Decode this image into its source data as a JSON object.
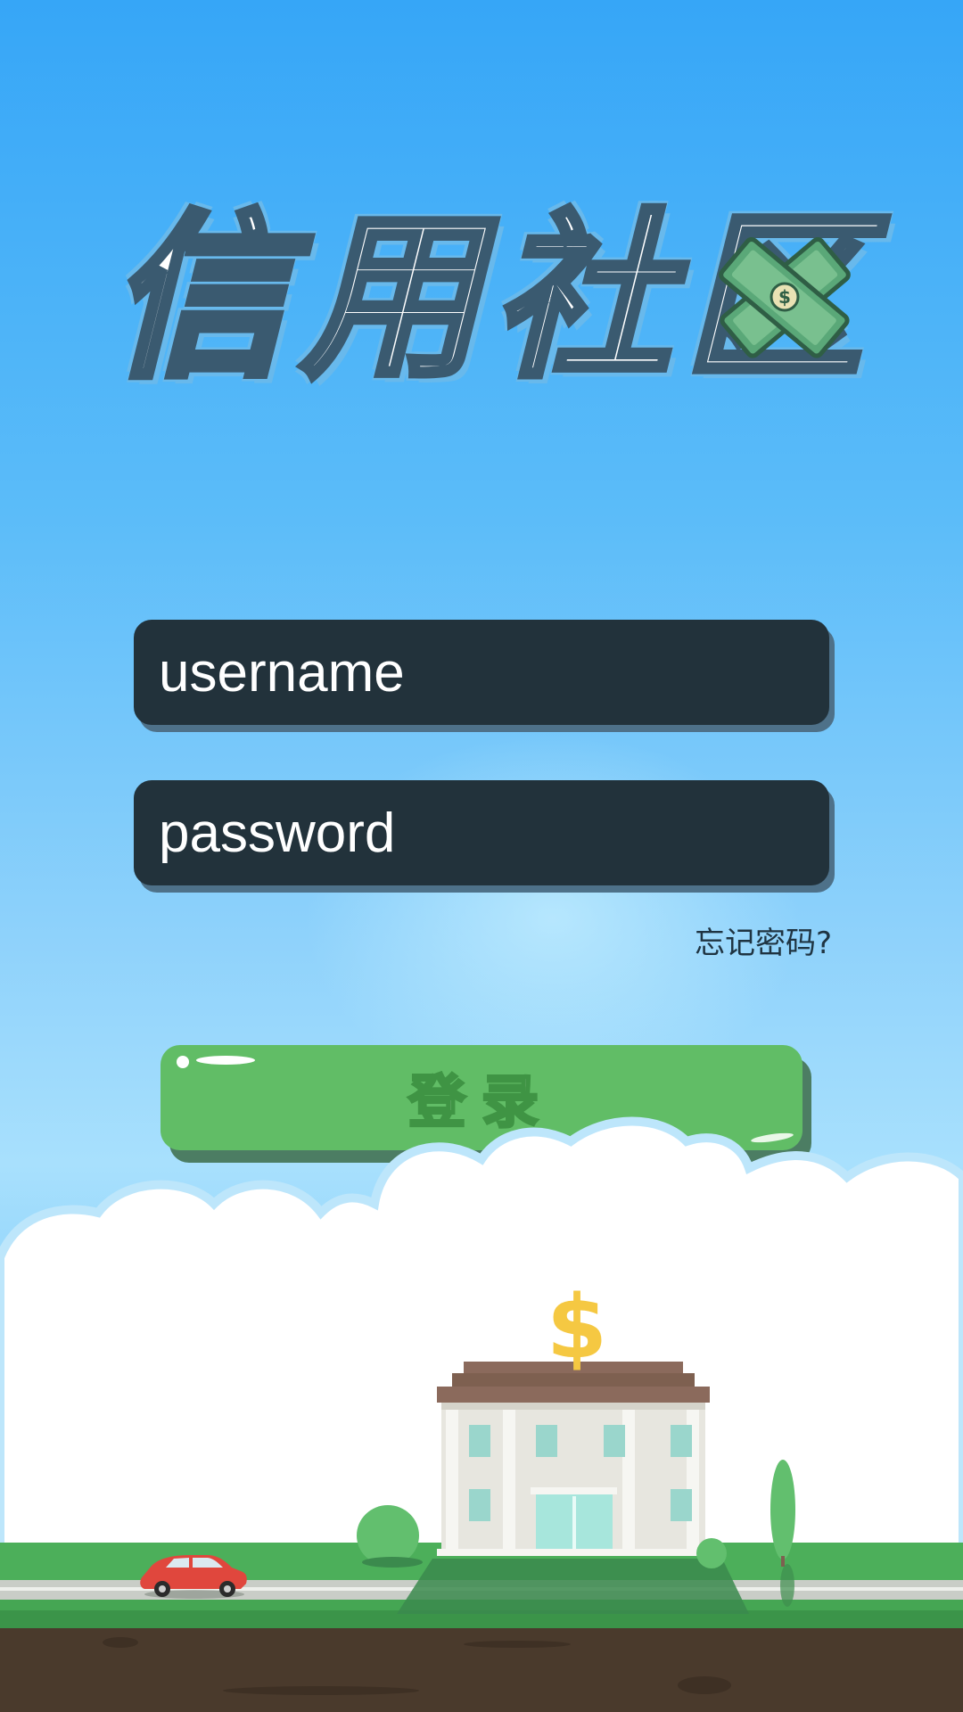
{
  "app": {
    "title_chars": [
      "信",
      "用",
      "社",
      "区"
    ]
  },
  "login_form": {
    "username_placeholder": "username",
    "password_placeholder": "password",
    "forgot_password": "忘记密码?",
    "login_button": "登录"
  },
  "illustration": {
    "building_symbol": "$",
    "icons": [
      "dollar-bill-icon",
      "bank-building",
      "red-car",
      "bush",
      "tree",
      "clouds"
    ]
  },
  "colors": {
    "sky_top": "#36a6f7",
    "input_bg": "#22323b",
    "button_green": "#61bd66",
    "grass_green": "#4caf5a",
    "ground_brown": "#4a3a2c"
  }
}
